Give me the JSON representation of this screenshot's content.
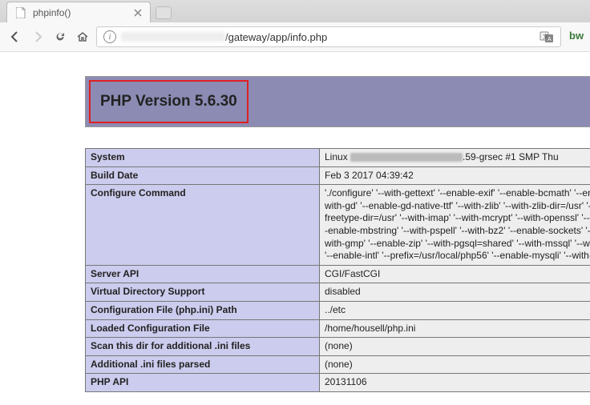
{
  "tab": {
    "title": "phpinfo()"
  },
  "url": {
    "path": "/gateway/app/info.php"
  },
  "header": {
    "title": "PHP Version 5.6.30"
  },
  "rows": [
    {
      "k": "System",
      "v": ".59-grsec #1 SMP Thu",
      "prefix": "Linux ",
      "blur": true
    },
    {
      "k": "Build Date",
      "v": "Feb 3 2017 04:39:42"
    },
    {
      "k": "Configure Command",
      "v": "'./configure' '--with-gettext' '--enable-exif' '--enable-bcmath' '--enable-ftp' '--with-gd' '--enable-gd-native-ttf' '--with-zlib' '--with-zlib-dir=/usr' '--with-freetype-dir=/usr' '--with-imap' '--with-mcrypt' '--with-openssl' '--with-ldap' '--enable-mbstring' '--with-pspell' '--with-bz2' '--enable-sockets' '--with-xsl' '--with-gmp' '--enable-zip' '--with-pgsql=shared' '--with-mssql' '--with-xmlrpc' '--enable-intl' '--prefix=/usr/local/php56' '--enable-mysqli' '--with-pdo-mysql'"
    },
    {
      "k": "Server API",
      "v": "CGI/FastCGI"
    },
    {
      "k": "Virtual Directory Support",
      "v": "disabled"
    },
    {
      "k": "Configuration File (php.ini) Path",
      "v": "../etc"
    },
    {
      "k": "Loaded Configuration File",
      "v": "/home/housell/php.ini"
    },
    {
      "k": "Scan this dir for additional .ini files",
      "v": "(none)"
    },
    {
      "k": "Additional .ini files parsed",
      "v": "(none)"
    },
    {
      "k": "PHP API",
      "v": "20131106"
    }
  ]
}
